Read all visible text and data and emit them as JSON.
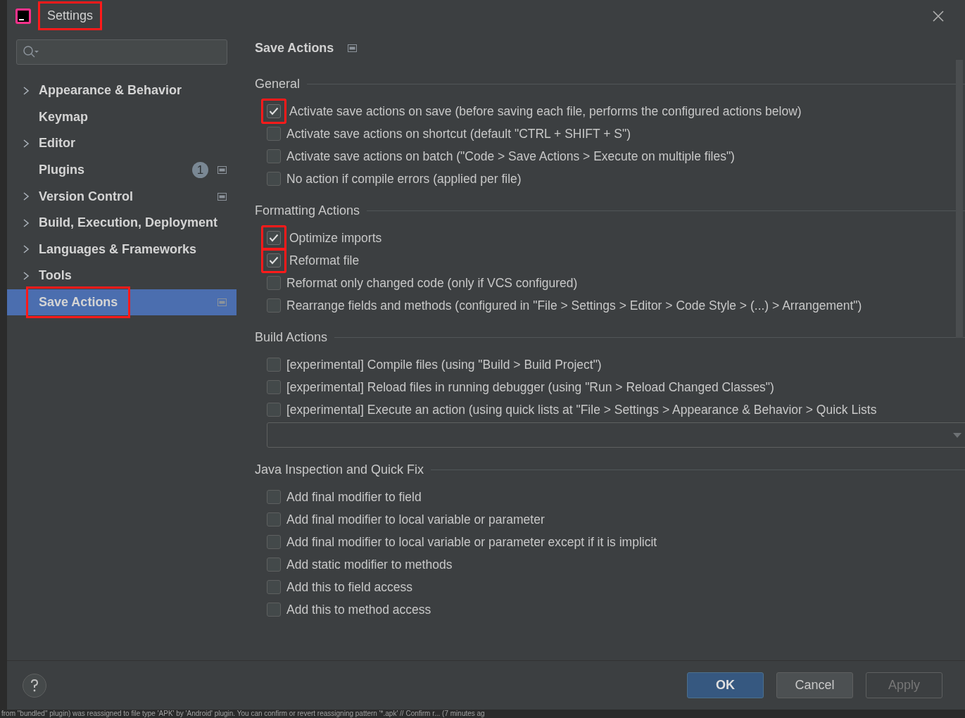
{
  "window": {
    "title": "Settings",
    "title_highlighted": true
  },
  "sidebar": {
    "items": [
      {
        "label": "Appearance & Behavior",
        "expandable": true,
        "selected": false,
        "highlighted": false,
        "page_icon": false
      },
      {
        "label": "Keymap",
        "expandable": false,
        "selected": false,
        "highlighted": false,
        "page_icon": false
      },
      {
        "label": "Editor",
        "expandable": true,
        "selected": false,
        "highlighted": false,
        "page_icon": false
      },
      {
        "label": "Plugins",
        "expandable": false,
        "selected": false,
        "highlighted": false,
        "badge": "1",
        "page_icon": true
      },
      {
        "label": "Version Control",
        "expandable": true,
        "selected": false,
        "highlighted": false,
        "page_icon": true
      },
      {
        "label": "Build, Execution, Deployment",
        "expandable": true,
        "selected": false,
        "highlighted": false,
        "page_icon": false
      },
      {
        "label": "Languages & Frameworks",
        "expandable": true,
        "selected": false,
        "highlighted": false,
        "page_icon": false
      },
      {
        "label": "Tools",
        "expandable": true,
        "selected": false,
        "highlighted": false,
        "page_icon": false
      },
      {
        "label": "Save Actions",
        "expandable": false,
        "selected": true,
        "highlighted": true,
        "page_icon": true
      }
    ]
  },
  "page": {
    "title": "Save Actions",
    "sections": [
      {
        "title": "General",
        "items": [
          {
            "kind": "checkbox",
            "label": "Activate save actions on save (before saving each file, performs the configured actions below)",
            "checked": true,
            "highlighted": true
          },
          {
            "kind": "checkbox",
            "label": "Activate save actions on shortcut (default \"CTRL + SHIFT + S\")",
            "checked": false,
            "highlighted": false
          },
          {
            "kind": "checkbox",
            "label": "Activate save actions on batch (\"Code > Save Actions > Execute on multiple files\")",
            "checked": false,
            "highlighted": false
          },
          {
            "kind": "checkbox",
            "label": "No action if compile errors (applied per file)",
            "checked": false,
            "highlighted": false
          }
        ]
      },
      {
        "title": "Formatting Actions",
        "items": [
          {
            "kind": "checkbox",
            "label": "Optimize imports",
            "checked": true,
            "highlighted": true
          },
          {
            "kind": "checkbox",
            "label": "Reformat file",
            "checked": true,
            "highlighted": true
          },
          {
            "kind": "checkbox",
            "label": "Reformat only changed code (only if VCS configured)",
            "checked": false,
            "highlighted": false
          },
          {
            "kind": "checkbox",
            "label": "Rearrange fields and methods (configured in \"File > Settings > Editor > Code Style > (...) > Arrangement\")",
            "checked": false,
            "highlighted": false
          }
        ]
      },
      {
        "title": "Build Actions",
        "items": [
          {
            "kind": "checkbox",
            "label": "[experimental] Compile files (using \"Build > Build Project\")",
            "checked": false,
            "highlighted": false
          },
          {
            "kind": "checkbox",
            "label": "[experimental] Reload files in running debugger (using \"Run > Reload Changed Classes\")",
            "checked": false,
            "highlighted": false
          },
          {
            "kind": "checkbox",
            "label": "[experimental] Execute an action (using quick lists at \"File > Settings > Appearance & Behavior > Quick Lists",
            "checked": false,
            "highlighted": false
          },
          {
            "kind": "dropdown",
            "value": ""
          }
        ]
      },
      {
        "title": "Java Inspection and Quick Fix",
        "items": [
          {
            "kind": "checkbox",
            "label": "Add final modifier to field",
            "checked": false,
            "highlighted": false
          },
          {
            "kind": "checkbox",
            "label": "Add final modifier to local variable or parameter",
            "checked": false,
            "highlighted": false
          },
          {
            "kind": "checkbox",
            "label": "Add final modifier to local variable or parameter except if it is implicit",
            "checked": false,
            "highlighted": false
          },
          {
            "kind": "checkbox",
            "label": "Add static modifier to methods",
            "checked": false,
            "highlighted": false
          },
          {
            "kind": "checkbox",
            "label": "Add this to field access",
            "checked": false,
            "highlighted": false
          },
          {
            "kind": "checkbox",
            "label": "Add this to method access",
            "checked": false,
            "highlighted": false
          }
        ]
      }
    ]
  },
  "buttons": [
    {
      "label": "OK",
      "kind": "primary",
      "disabled": false
    },
    {
      "label": "Cancel",
      "kind": "normal",
      "disabled": false
    },
    {
      "label": "Apply",
      "kind": "normal",
      "disabled": true
    }
  ],
  "status_bar": {
    "text": "from \"bundled\" plugin) was reassigned to file type 'APK' by 'Android' plugin. You can confirm or revert reassigning pattern '*.apk' // Confirm r... (7 minutes ag"
  }
}
